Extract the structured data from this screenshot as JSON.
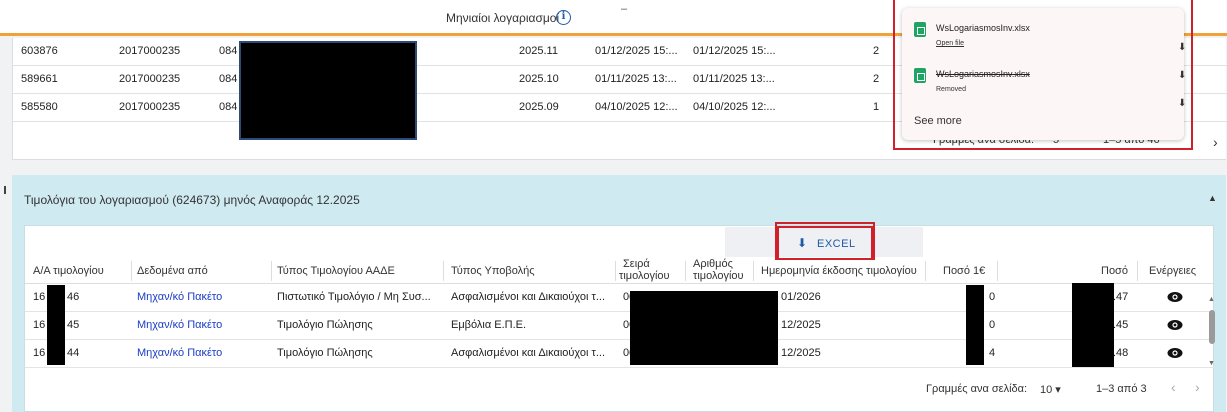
{
  "header": {
    "title": "Μηνιαίοι λογαριασμοί",
    "info_icon": "i",
    "dash": "–"
  },
  "upper_table": {
    "rows": [
      {
        "id": "603876",
        "code": "2017000235",
        "prefix": "084",
        "period": "2025.11",
        "date1": "01/12/2025 15:...",
        "date2": "01/12/2025 15:...",
        "count": "2"
      },
      {
        "id": "589661",
        "code": "2017000235",
        "prefix": "084",
        "period": "2025.10",
        "date1": "01/11/2025 13:...",
        "date2": "01/11/2025 13:...",
        "count": "2"
      },
      {
        "id": "585580",
        "code": "2017000235",
        "prefix": "084",
        "period": "2025.09",
        "date1": "04/10/2025 12:...",
        "date2": "04/10/2025 12:...",
        "count": "1"
      }
    ],
    "footer": {
      "rows_per_page_label": "Γραμμες ανα σελιδα:",
      "rows_per_page": "5",
      "range": "1–5 απο 46",
      "next": "›"
    }
  },
  "downloads": {
    "items": [
      {
        "file": "WsLogariasmosInv.xlsx",
        "status": "Open file"
      },
      {
        "file": "WsLogariasmosInv.xlsx",
        "status": "Removed"
      }
    ],
    "see_more": "See more"
  },
  "invoices": {
    "title": "Τιμολόγια του λογαριασμού (624673) μηνός Αναφοράς 12.2025",
    "collapse_icon": "▲",
    "excel_label": "EXCEL",
    "excel_icon": "⬇",
    "columns": [
      "Α/Α τιμολογίου",
      "Δεδομένα από",
      "Τύπος Τιμολογίου ΑΑΔΕ",
      "Τύπος Υποβολής",
      "Σειρά",
      "τιμολογίου",
      "Αριθμός",
      "τιμολογίου",
      "Ημερομηνία έκδοσης τιμολογίου",
      "Ποσό 1€",
      "Ποσό",
      "Ενέργειες"
    ],
    "rows": [
      {
        "aa_start": "16",
        "aa_end": "46",
        "source": "Μηχαν/κό Πακέτο",
        "type": "Πιστωτικό Τιμολόγιο / Μη Συσ...",
        "submission": "Ασφαλισμένοι και Δικαιούχοι τ...",
        "series": "00",
        "date": "01/2026",
        "amount1": "0",
        "amount": ".47"
      },
      {
        "aa_start": "16",
        "aa_end": "45",
        "source": "Μηχαν/κό Πακέτο",
        "type": "Τιμολόγιο Πώλησης",
        "submission": "Εμβόλια Ε.Π.Ε.",
        "series": "00",
        "date": "12/2025",
        "amount1": "0",
        "amount": ".45"
      },
      {
        "aa_start": "16",
        "aa_end": "44",
        "source": "Μηχαν/κό Πακέτο",
        "type": "Τιμολόγιο Πώλησης",
        "submission": "Ασφαλισμένοι και Δικαιούχοι τ...",
        "series": "00",
        "date": "12/2025",
        "amount1": "4",
        "amount": ".48"
      }
    ],
    "footer": {
      "rows_per_page_label": "Γραμμές ανα σελίδα:",
      "rows_per_page": "10 ▾",
      "range": "1–3 από 3",
      "prev": "‹",
      "next": "›"
    }
  },
  "colors": {
    "accent": "#f0a23a",
    "link": "#1a3cc8",
    "highlight": "#d0212a",
    "panel": "#cfeaf1",
    "sheet": "#1fa463"
  }
}
